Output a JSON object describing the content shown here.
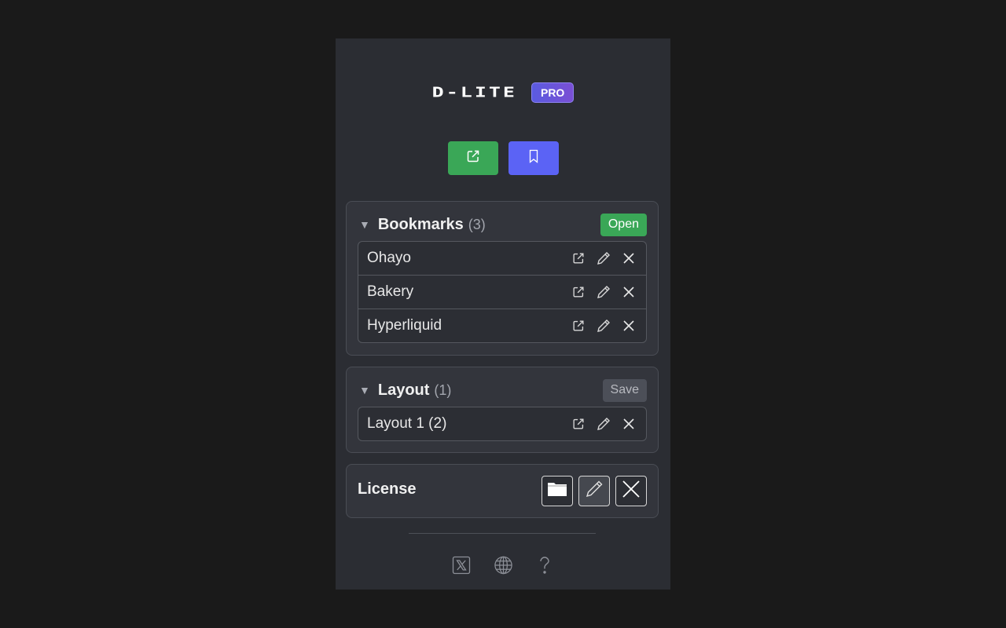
{
  "header": {
    "logo_text": "D-LITE",
    "badge": "PRO"
  },
  "actions": {
    "primary_icon": "external-link-icon",
    "secondary_icon": "bookmark-icon",
    "colors": {
      "green": "#3aa757",
      "blue": "#5b63f5"
    }
  },
  "bookmarks": {
    "title": "Bookmarks",
    "count": "(3)",
    "open_label": "Open",
    "items": [
      {
        "label": "Ohayo"
      },
      {
        "label": "Bakery"
      },
      {
        "label": "Hyperliquid"
      }
    ]
  },
  "layout": {
    "title": "Layout",
    "count": "(1)",
    "save_label": "Save",
    "items": [
      {
        "label": "Layout 1 (2)"
      }
    ]
  },
  "license": {
    "title": "License",
    "icons": [
      "folder-icon",
      "pencil-icon",
      "close-icon"
    ]
  },
  "footer": {
    "icons": [
      "x-logo-icon",
      "globe-icon",
      "help-icon"
    ]
  }
}
